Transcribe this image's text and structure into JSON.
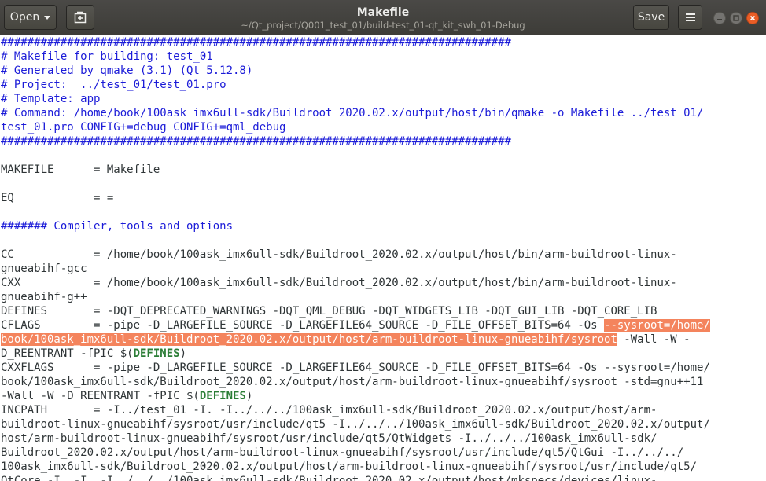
{
  "header": {
    "open_label": "Open",
    "title": "Makefile",
    "subtitle": "~/Qt_project/Q001_test_01/build-test_01-qt_kit_swh_01-Debug",
    "save_label": "Save",
    "icons": {
      "new_tab": "new-document-icon",
      "menu": "hamburger-menu-icon",
      "minimize": "minimize-icon",
      "maximize": "maximize-icon",
      "close": "close-icon"
    },
    "colors": {
      "close_button": "#e95d26",
      "comment": "#1b1bd8",
      "keyword": "#2b7d36",
      "selection": "#f4845d"
    }
  },
  "editor": {
    "lines": [
      [
        {
          "t": "#############################################################################",
          "c": "c"
        }
      ],
      [
        {
          "t": "# Makefile for building: test_01",
          "c": "c"
        }
      ],
      [
        {
          "t": "# Generated by qmake (3.1) (Qt 5.12.8)",
          "c": "c"
        }
      ],
      [
        {
          "t": "# Project:  ../test_01/test_01.pro",
          "c": "c"
        }
      ],
      [
        {
          "t": "# Template: app",
          "c": "c"
        }
      ],
      [
        {
          "t": "# Command: /home/book/100ask_imx6ull-sdk/Buildroot_2020.02.x/output/host/bin/qmake -o Makefile ../test_01/",
          "c": "c"
        }
      ],
      [
        {
          "t": "test_01.pro CONFIG+=debug CONFIG+=qml_debug",
          "c": "c"
        }
      ],
      [
        {
          "t": "#############################################################################",
          "c": "c"
        }
      ],
      [],
      [
        {
          "t": "MAKEFILE      = Makefile"
        }
      ],
      [],
      [
        {
          "t": "EQ            = ="
        }
      ],
      [],
      [
        {
          "t": "####### Compiler, tools and options",
          "c": "c"
        }
      ],
      [],
      [
        {
          "t": "CC            = /home/book/100ask_imx6ull-sdk/Buildroot_2020.02.x/output/host/bin/arm-buildroot-linux-"
        }
      ],
      [
        {
          "t": "gnueabihf-gcc"
        }
      ],
      [
        {
          "t": "CXX           = /home/book/100ask_imx6ull-sdk/Buildroot_2020.02.x/output/host/bin/arm-buildroot-linux-"
        }
      ],
      [
        {
          "t": "gnueabihf-g++"
        }
      ],
      [
        {
          "t": "DEFINES       = -DQT_DEPRECATED_WARNINGS -DQT_QML_DEBUG -DQT_WIDGETS_LIB -DQT_GUI_LIB -DQT_CORE_LIB"
        }
      ],
      [
        {
          "t": "CFLAGS        = -pipe -D_LARGEFILE_SOURCE -D_LARGEFILE64_SOURCE -D_FILE_OFFSET_BITS=64 -Os "
        },
        {
          "t": "--sysroot=/home/",
          "c": "h"
        }
      ],
      [
        {
          "t": "book/100ask_imx6ull-sdk/Buildroot_2020.02.x/output/host/arm-buildroot-linux-gnueabihf/sysroot",
          "c": "h"
        },
        {
          "t": " -Wall -W -"
        }
      ],
      [
        {
          "t": "D_REENTRANT -fPIC $("
        },
        {
          "t": "DEFINES",
          "c": "k"
        },
        {
          "t": ")"
        }
      ],
      [
        {
          "t": "CXXFLAGS      = -pipe -D_LARGEFILE_SOURCE -D_LARGEFILE64_SOURCE -D_FILE_OFFSET_BITS=64 -Os --sysroot=/home/"
        }
      ],
      [
        {
          "t": "book/100ask_imx6ull-sdk/Buildroot_2020.02.x/output/host/arm-buildroot-linux-gnueabihf/sysroot -std=gnu++11"
        }
      ],
      [
        {
          "t": "-Wall -W -D_REENTRANT -fPIC $("
        },
        {
          "t": "DEFINES",
          "c": "k"
        },
        {
          "t": ")"
        }
      ],
      [
        {
          "t": "INCPATH       = -I../test_01 -I. -I../../../100ask_imx6ull-sdk/Buildroot_2020.02.x/output/host/arm-"
        }
      ],
      [
        {
          "t": "buildroot-linux-gnueabihf/sysroot/usr/include/qt5 -I../../../100ask_imx6ull-sdk/Buildroot_2020.02.x/output/"
        }
      ],
      [
        {
          "t": "host/arm-buildroot-linux-gnueabihf/sysroot/usr/include/qt5/QtWidgets -I../../../100ask_imx6ull-sdk/"
        }
      ],
      [
        {
          "t": "Buildroot_2020.02.x/output/host/arm-buildroot-linux-gnueabihf/sysroot/usr/include/qt5/QtGui -I../../../"
        }
      ],
      [
        {
          "t": "100ask_imx6ull-sdk/Buildroot_2020.02.x/output/host/arm-buildroot-linux-gnueabihf/sysroot/usr/include/qt5/"
        }
      ],
      [
        {
          "t": "QtCore -I. -I. -I../../../100ask_imx6ull-sdk/Buildroot_2020.02.x/output/host/mkspecs/devices/linux-"
        }
      ]
    ]
  }
}
